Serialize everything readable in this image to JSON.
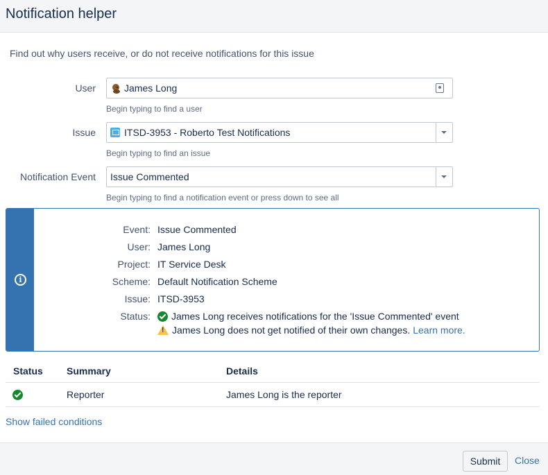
{
  "dialog": {
    "title": "Notification helper"
  },
  "intro": "Find out why users receive, or do not receive notifications for this issue",
  "form": {
    "user": {
      "label": "User",
      "value": "James Long",
      "help": "Begin typing to find a user"
    },
    "issue": {
      "label": "Issue",
      "value": "ITSD-3953 - Roberto Test Notifications",
      "help": "Begin typing to find an issue"
    },
    "event": {
      "label": "Notification Event",
      "value": "Issue Commented",
      "help": "Begin typing to find a notification event or press down to see all"
    }
  },
  "info": {
    "event": {
      "label": "Event:",
      "value": "Issue Commented"
    },
    "user": {
      "label": "User:",
      "value": "James Long"
    },
    "project": {
      "label": "Project:",
      "value": "IT Service Desk"
    },
    "scheme": {
      "label": "Scheme:",
      "value": "Default Notification Scheme"
    },
    "issue": {
      "label": "Issue:",
      "value": "ITSD-3953"
    },
    "status": {
      "label": "Status:",
      "line1": "James Long receives notifications for the 'Issue Commented' event",
      "line2": "James Long does not get notified of their own changes.",
      "learn_more": "Learn more."
    }
  },
  "table": {
    "headers": [
      "Status",
      "Summary",
      "Details"
    ],
    "rows": [
      {
        "summary": "Reporter",
        "details": "James Long is the reporter"
      }
    ]
  },
  "show_failed": "Show failed conditions",
  "footer": {
    "submit": "Submit",
    "close": "Close"
  },
  "colors": {
    "accent": "#3572b0",
    "success": "#14892c",
    "warning": "#f6c342"
  },
  "icons": {
    "info": "info-icon",
    "success": "check-circle-icon",
    "warning": "warning-icon",
    "user_avatar": "avatar",
    "issue_type": "issue-type-icon",
    "user_picker": "contact-card-icon",
    "dropdown": "chevron-down-icon"
  }
}
